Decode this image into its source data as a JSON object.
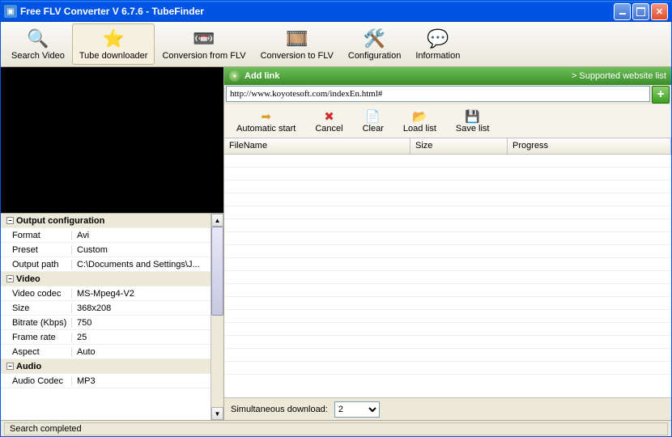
{
  "window": {
    "title": "Free FLV Converter V 6.7.6 - TubeFinder"
  },
  "toolbar": {
    "search": "Search Video",
    "tube": "Tube downloader",
    "convfrom": "Conversion from FLV",
    "convto": "Conversion to FLV",
    "config": "Configuration",
    "info": "Information"
  },
  "props": {
    "output_header": "Output configuration",
    "format_label": "Format",
    "format_value": "Avi",
    "preset_label": "Preset",
    "preset_value": "Custom",
    "outpath_label": "Output path",
    "outpath_value": "C:\\Documents and Settings\\J...",
    "video_header": "Video",
    "vcodec_label": "Video codec",
    "vcodec_value": "MS-Mpeg4-V2",
    "size_label": "Size",
    "size_value": "368x208",
    "bitrate_label": "Bitrate (Kbps)",
    "bitrate_value": "750",
    "framerate_label": "Frame rate",
    "framerate_value": "25",
    "aspect_label": "Aspect",
    "aspect_value": "Auto",
    "audio_header": "Audio",
    "acodec_label": "Audio Codec",
    "acodec_value": "MP3"
  },
  "addlink": {
    "title": "Add link",
    "supported": "> Supported website list"
  },
  "url": {
    "value": "http://www.koyotesoft.com/indexEn.html#"
  },
  "actions": {
    "auto": "Automatic start",
    "cancel": "Cancel",
    "clear": "Clear",
    "load": "Load list",
    "save": "Save list"
  },
  "list": {
    "col_file": "FileName",
    "col_size": "Size",
    "col_prog": "Progress"
  },
  "bottom": {
    "simul_label": "Simultaneous download:",
    "simul_value": "2"
  },
  "status": {
    "text": "Search completed"
  }
}
